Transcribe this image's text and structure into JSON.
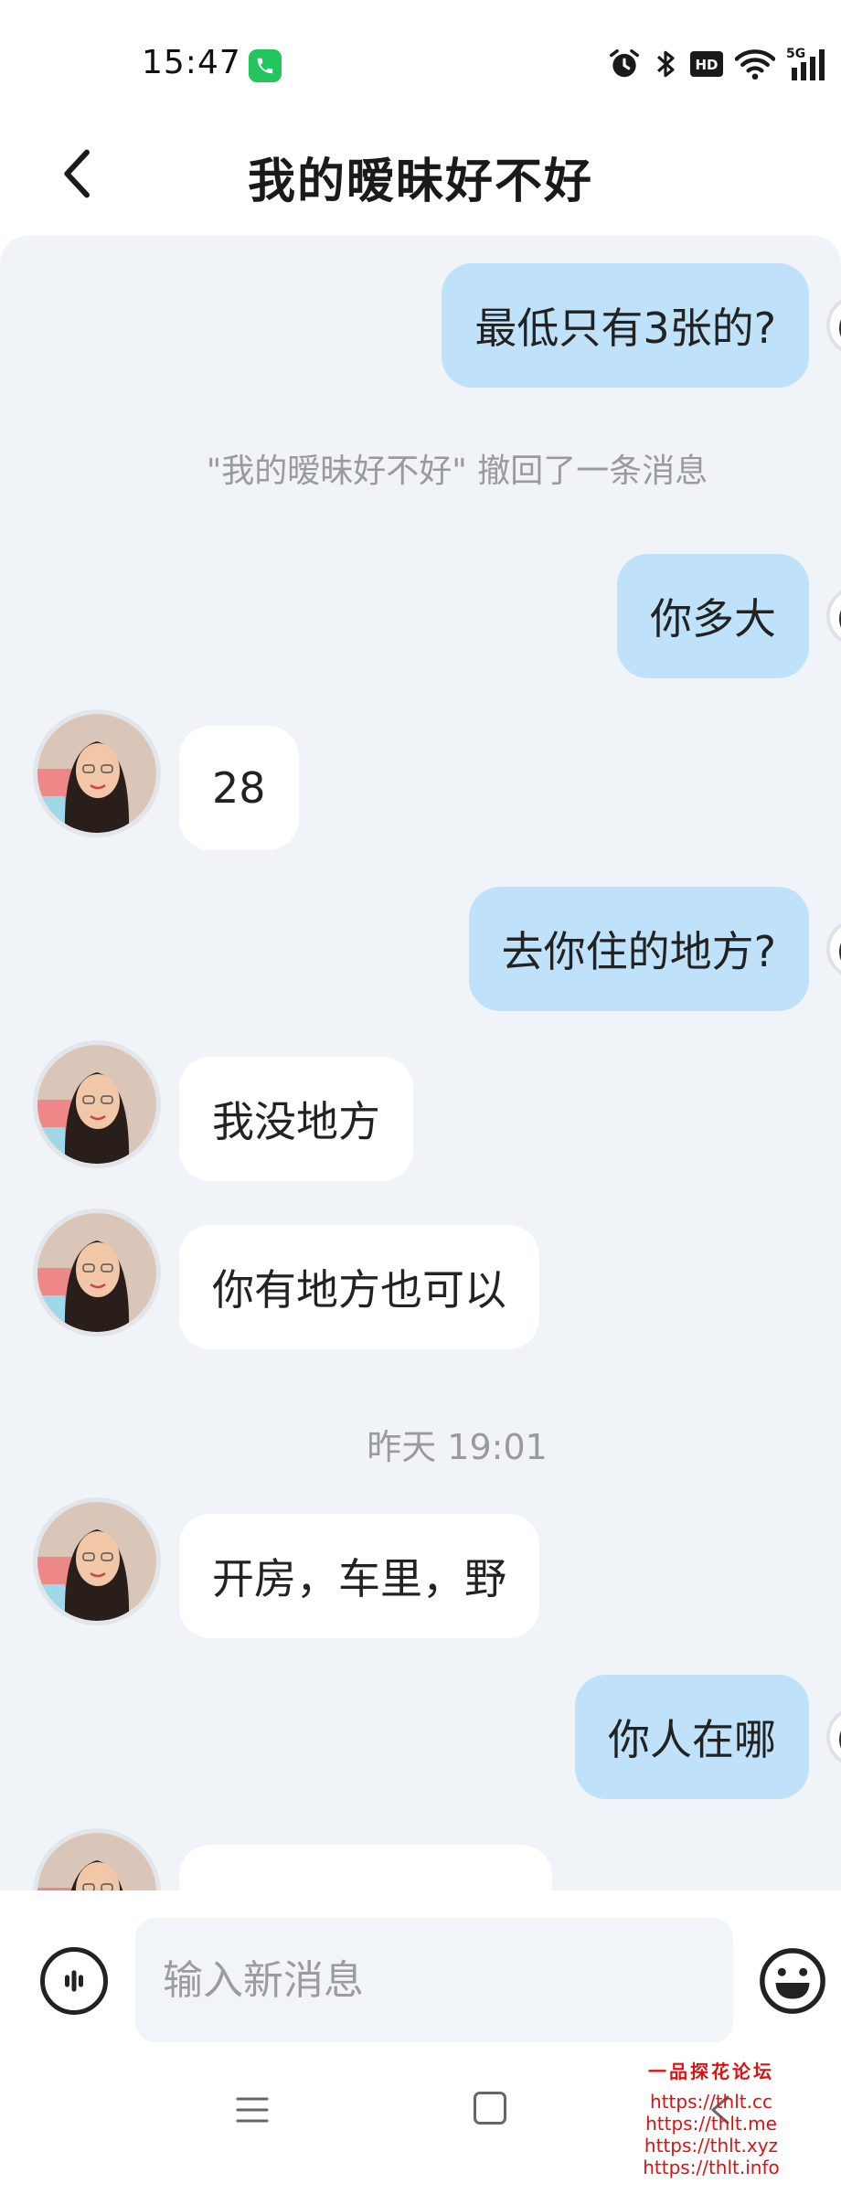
{
  "status_bar": {
    "time": "15:47",
    "icons": [
      "call-active-icon",
      "alarm-icon",
      "bluetooth-icon",
      "hd-icon",
      "wifi-icon",
      "5g-signal-icon"
    ],
    "hd_label": "HD",
    "network_label": "5G"
  },
  "header": {
    "title": "我的暧昧好不好",
    "back_icon": "chevron-left-icon"
  },
  "messages": [
    {
      "side": "out",
      "text": "最低只有3张的?"
    },
    {
      "side": "system",
      "text": "\"我的暧昧好不好\" 撤回了一条消息"
    },
    {
      "side": "out",
      "text": "你多大"
    },
    {
      "side": "in",
      "text": "28"
    },
    {
      "side": "out",
      "text": "去你住的地方?"
    },
    {
      "side": "in",
      "text": "我没地方"
    },
    {
      "side": "in",
      "text": "你有地方也可以"
    },
    {
      "side": "timestamp",
      "text": "昨天 19:01"
    },
    {
      "side": "in",
      "text": "开房，车里，野"
    },
    {
      "side": "out",
      "text": "你人在哪"
    },
    {
      "side": "in",
      "text": ""
    }
  ],
  "input": {
    "placeholder": "输入新消息",
    "voice_icon": "voice-wave-icon",
    "emoji_icon": "smile-emoji-icon"
  },
  "navbar": {
    "items": [
      "menu-icon",
      "home-icon",
      "back-icon"
    ]
  },
  "watermark": {
    "title": "一品探花论坛",
    "links": [
      "https://thlt.cc",
      "https://thlt.me",
      "https://thlt.xyz",
      "https://thlt.info"
    ]
  },
  "colors": {
    "outgoing_bubble": "#bfe1fa",
    "incoming_bubble": "#ffffff",
    "chat_background": "#f0f4f9",
    "call_badge": "#22c55e",
    "watermark": "#dd1111"
  }
}
